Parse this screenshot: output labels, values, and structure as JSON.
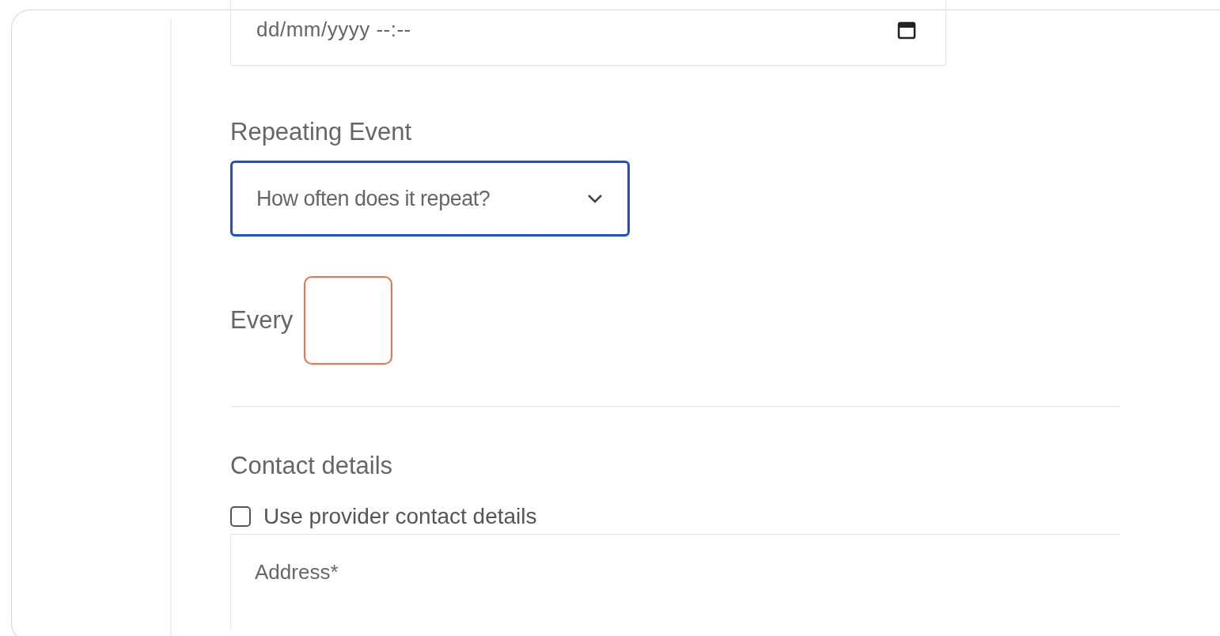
{
  "date_field": {
    "placeholder": "dd/mm/yyyy --:--"
  },
  "repeating_event": {
    "label": "Repeating Event",
    "select": {
      "placeholder": "How often does it repeat?",
      "focused": true
    }
  },
  "every": {
    "label": "Every",
    "invalid": true
  },
  "contact": {
    "heading": "Contact details",
    "use_provider": {
      "label": "Use provider contact details",
      "checked": false
    },
    "address": {
      "placeholder": "Address*"
    }
  }
}
